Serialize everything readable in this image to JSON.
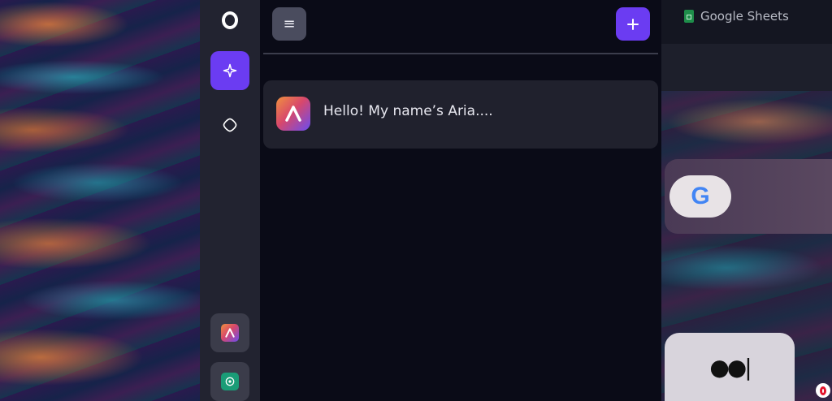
{
  "background_browser": {
    "tab_label": "Google Sheets",
    "google_logo_letter": "G"
  },
  "sidebar": {
    "items": [
      {
        "name": "opera-logo"
      },
      {
        "name": "aria-sparkle",
        "active": true
      },
      {
        "name": "lens"
      },
      {
        "name": "aria-extension"
      },
      {
        "name": "chatgpt"
      }
    ]
  },
  "chat_panel": {
    "menu_icon": "≡",
    "new_chat_icon": "+",
    "chats": [
      {
        "text": "Hello! My name’s Aria....",
        "avatar": "aria-logo-icon"
      }
    ]
  },
  "colors": {
    "accent": "#6b3cf2",
    "panel_bg": "#0a0b17",
    "sidebar_bg": "#222330",
    "chat_item_bg": "#20212d"
  }
}
